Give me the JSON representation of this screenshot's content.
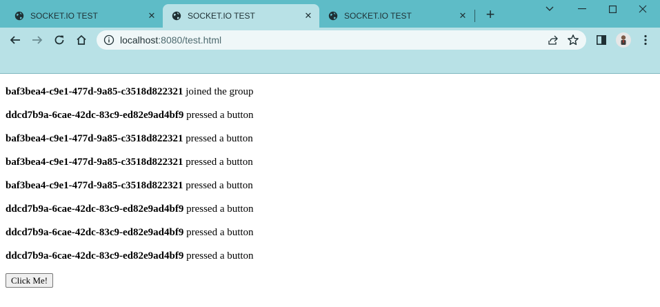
{
  "browser": {
    "tabs": [
      {
        "title": "SOCKET.IO TEST",
        "active": false
      },
      {
        "title": "SOCKET.IO TEST",
        "active": true
      },
      {
        "title": "SOCKET.IO TEST",
        "active": false
      }
    ],
    "address": {
      "host": "localhost",
      "path": ":8080/test.html"
    },
    "colors": {
      "frame": "#5ebcc7",
      "toolbar": "#b8e1e6",
      "omnibox": "#eff7f8"
    }
  },
  "messages": [
    {
      "user": "baf3bea4-c9e1-477d-9a85-c3518d822321",
      "action": " joined the group"
    },
    {
      "user": "ddcd7b9a-6cae-42dc-83c9-ed82e9ad4bf9",
      "action": " pressed a button"
    },
    {
      "user": "baf3bea4-c9e1-477d-9a85-c3518d822321",
      "action": " pressed a button"
    },
    {
      "user": "baf3bea4-c9e1-477d-9a85-c3518d822321",
      "action": " pressed a button"
    },
    {
      "user": "baf3bea4-c9e1-477d-9a85-c3518d822321",
      "action": " pressed a button"
    },
    {
      "user": "ddcd7b9a-6cae-42dc-83c9-ed82e9ad4bf9",
      "action": " pressed a button"
    },
    {
      "user": "ddcd7b9a-6cae-42dc-83c9-ed82e9ad4bf9",
      "action": " pressed a button"
    },
    {
      "user": "ddcd7b9a-6cae-42dc-83c9-ed82e9ad4bf9",
      "action": " pressed a button"
    }
  ],
  "button": {
    "label": "Click Me!"
  }
}
